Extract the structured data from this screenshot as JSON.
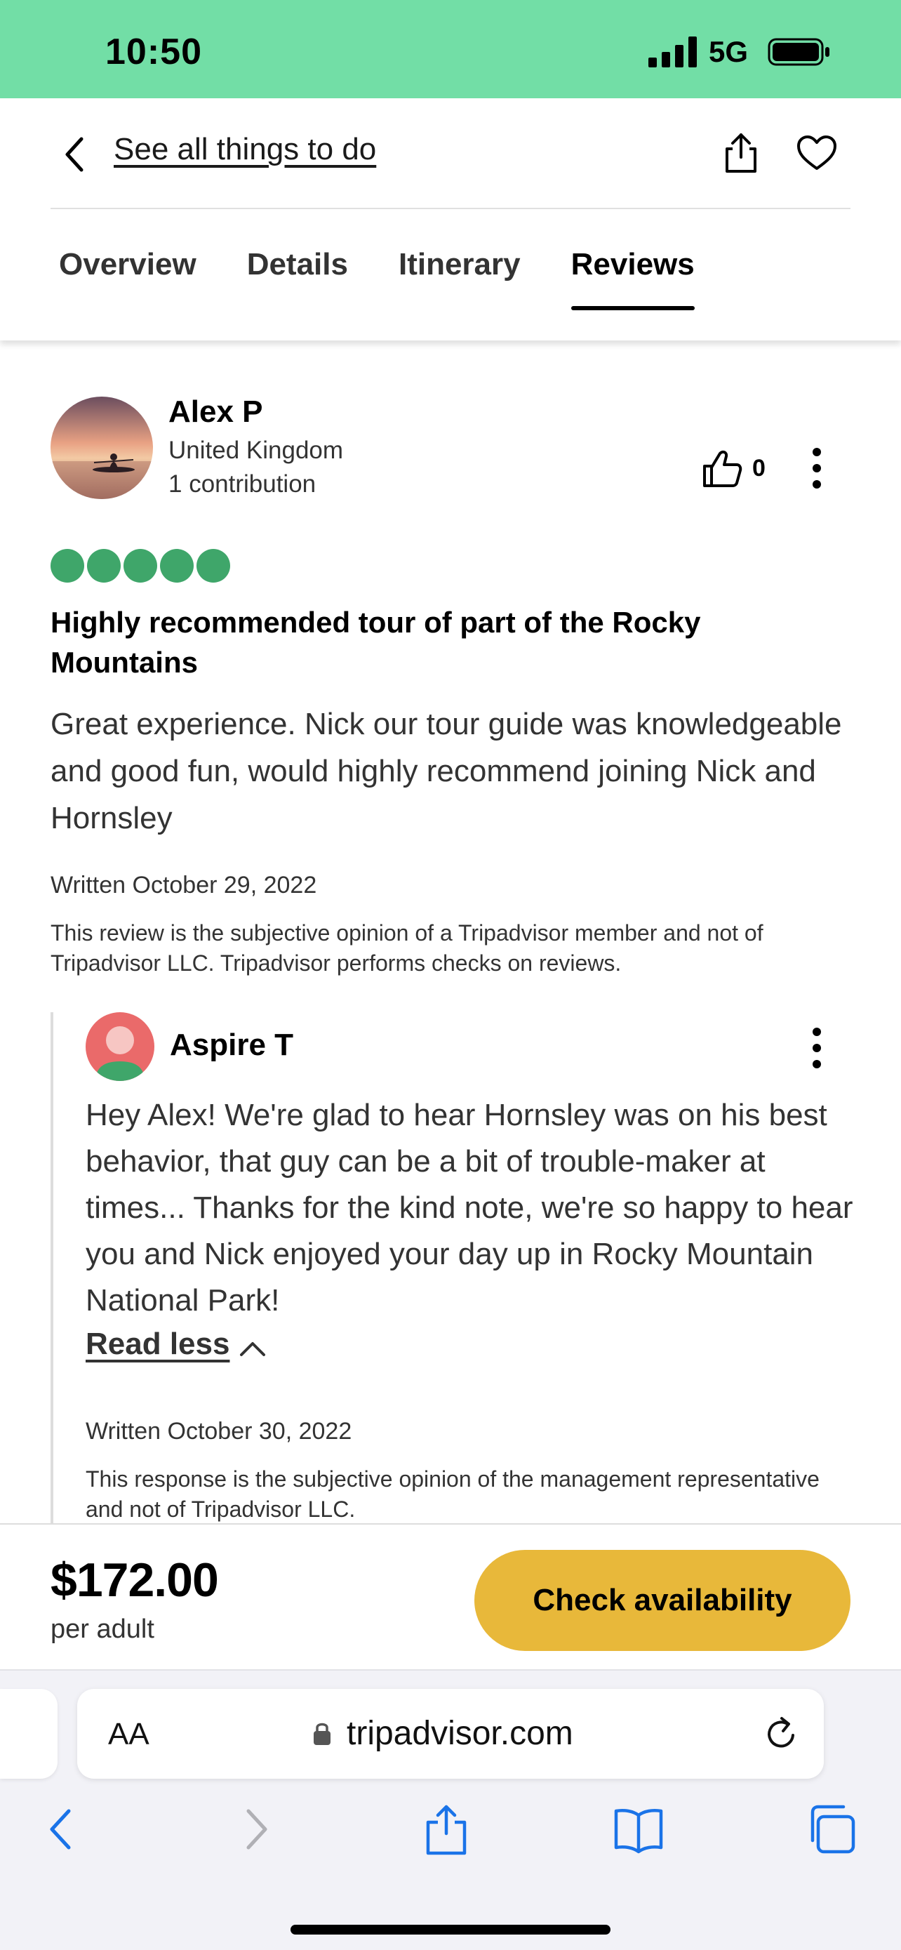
{
  "status_bar": {
    "time": "10:50",
    "network": "5G"
  },
  "header": {
    "back_link": "See all things to do",
    "tabs": [
      "Overview",
      "Details",
      "Itinerary",
      "Reviews"
    ],
    "active_tab": "Reviews"
  },
  "review": {
    "author": "Alex P",
    "location": "United Kingdom",
    "contributions": "1 contribution",
    "helpful_count": "0",
    "rating": 5,
    "title": "Highly recommended tour of part of the Rocky Mountains",
    "body": "Great experience. Nick our tour guide was knowledgeable and good fun, would highly recommend joining Nick and Hornsley",
    "date": "Written October 29, 2022",
    "disclaimer": "This review is the subjective opinion of a Tripadvisor member and not of Tripadvisor LLC. Tripadvisor performs checks on reviews."
  },
  "response": {
    "author": "Aspire T",
    "body": "Hey Alex! We're glad to hear Hornsley was on his best behavior, that guy can be a bit of trouble-maker at times... Thanks for the kind note, we're so happy to hear you and Nick enjoyed your day up in Rocky Mountain National Park!",
    "read_less": "Read less",
    "date": "Written October 30, 2022",
    "disclaimer": "This response is the subjective opinion of the management representative and not of Tripadvisor LLC."
  },
  "booking": {
    "price": "$172.00",
    "unit": "per adult",
    "cta": "Check availability"
  },
  "browser": {
    "text_size_label": "AA",
    "url": "tripadvisor.com",
    "toolbar_icons": [
      "back-icon",
      "forward-icon",
      "share-icon",
      "bookmarks-icon",
      "tabs-icon"
    ]
  },
  "colors": {
    "status_bar": "#72dea6",
    "rating_bubble": "#3fa66a",
    "cta": "#e8b83a",
    "browser_accent": "#1a73e8"
  }
}
